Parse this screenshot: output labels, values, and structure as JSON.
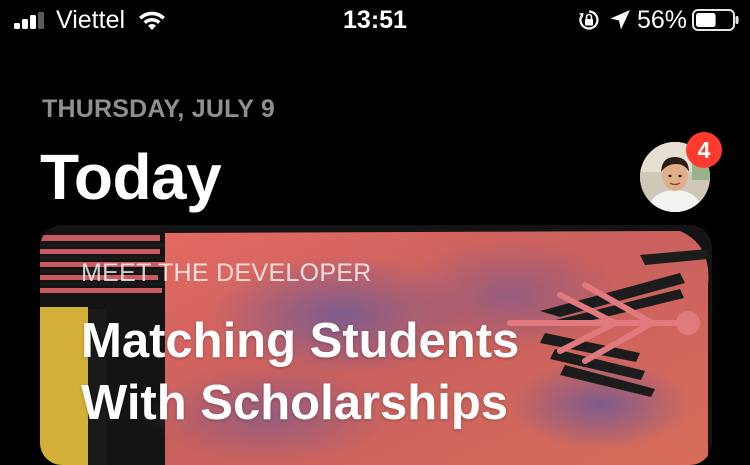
{
  "status_bar": {
    "carrier": "Viettel",
    "time": "13:51",
    "battery_percent": "56%",
    "signal_bars_filled": 3,
    "signal_bars_total": 4,
    "battery_level": 0.56,
    "icons": [
      "signal-icon",
      "wifi-icon",
      "rotation-lock-icon",
      "location-arrow-icon",
      "battery-icon"
    ]
  },
  "header": {
    "date": "THURSDAY, JULY 9",
    "title": "Today",
    "account_badge_count": "4"
  },
  "story_card": {
    "eyebrow": "MEET THE DEVELOPER",
    "title_line1": "Matching Students",
    "title_line2": "With Scholarships"
  },
  "colors": {
    "background": "#000000",
    "date_gray": "#8e8e93",
    "badge_red": "#ff3b30",
    "card_coral": "#d9695f",
    "card_purple": "#7c5a8c",
    "card_mustard": "#d4af37",
    "card_pink": "#e07a7e"
  }
}
